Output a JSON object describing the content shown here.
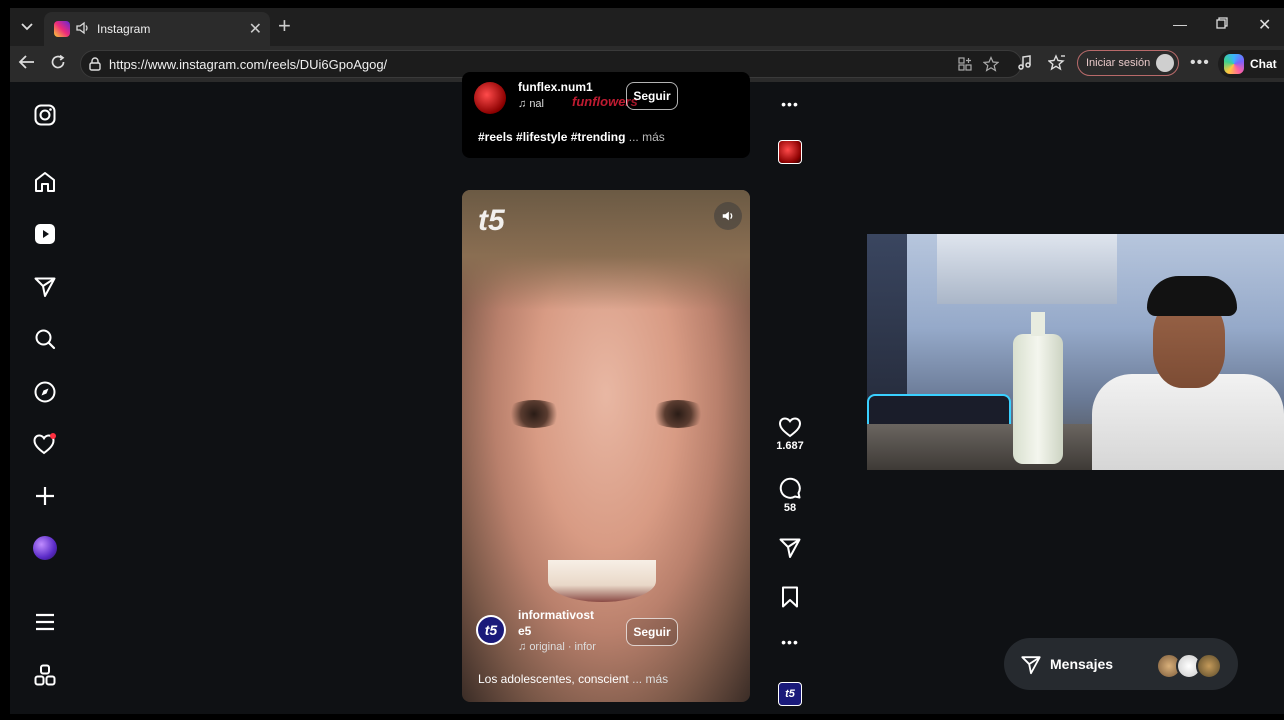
{
  "browser": {
    "tab_title": "Instagram",
    "url": "https://www.instagram.com/reels/DUi6GpoAgog/",
    "login_label": "Iniciar sesión",
    "chat_label": "Chat"
  },
  "reels": {
    "top": {
      "account": "funflex.num1",
      "audio": "nal",
      "follow_label": "Seguir",
      "caption": "#reels #lifestyle #trending",
      "more": "... más"
    },
    "main": {
      "account_line1": "informativost",
      "account_line2": "e5",
      "audio": "original · infor",
      "follow_label": "Seguir",
      "caption": "Los adolescentes, conscient",
      "more": "... más",
      "watermark": "t5",
      "likes": "1.687",
      "comments": "58"
    }
  },
  "messages": {
    "label": "Mensajes"
  },
  "colors": {
    "accent_login_border": "#b86a6a",
    "notification_dot": "#ff3040",
    "panel": "#262a2f"
  }
}
